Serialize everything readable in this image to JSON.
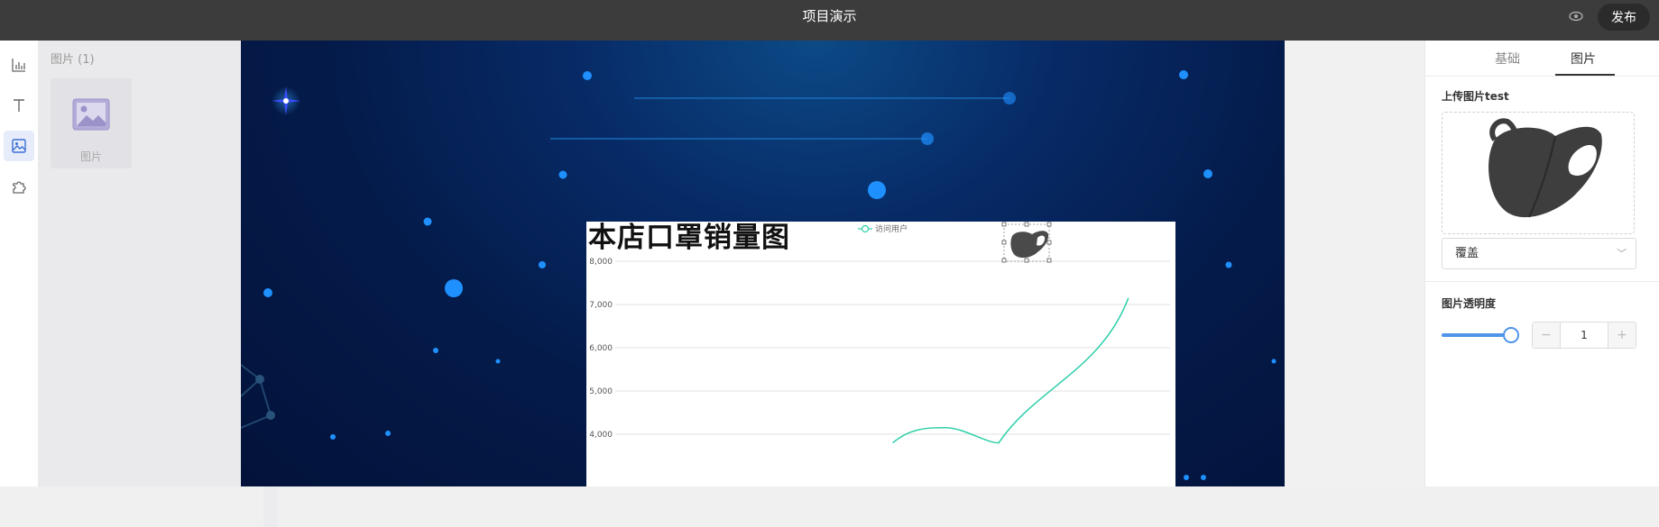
{
  "app": {
    "title": "项目演示",
    "publish_label": "发布"
  },
  "icons": {
    "preview": "eye-icon",
    "rail": [
      "chart-icon",
      "text-icon",
      "image-icon",
      "puzzle-icon"
    ]
  },
  "library": {
    "header": "图片 (1)",
    "items": [
      {
        "label": "图片",
        "icon": "image-placeholder-icon"
      }
    ]
  },
  "canvas": {
    "chart": {
      "title_text": "本店口罩销量图",
      "legend_label": "访问用户",
      "accent_color": "#2ecfa9"
    }
  },
  "chart_data": {
    "type": "line",
    "title": "本店口罩销量图",
    "series": [
      {
        "name": "访问用户",
        "color": "#2ecfa9"
      }
    ],
    "yticks": [
      "8,000",
      "7,000",
      "6,000",
      "5,000",
      "4,000"
    ],
    "ylim": [
      4000,
      8000
    ],
    "grid": true,
    "legend_position": "top-center",
    "curve_points": [
      {
        "x": 0.52,
        "y": 3800
      },
      {
        "x": 0.61,
        "y": 4150
      },
      {
        "x": 0.7,
        "y": 3800
      },
      {
        "x": 0.92,
        "y": 7150
      }
    ]
  },
  "properties": {
    "tabs": [
      {
        "label": "基础",
        "active": false
      },
      {
        "label": "图片",
        "active": true
      }
    ],
    "upload_label": "上传图片test",
    "fit_mode": "覆盖",
    "opacity_label": "图片透明度",
    "opacity_value": "1",
    "opacity_fraction": 1
  },
  "colors": {
    "topbar": "#3c3c3c",
    "accent_blue": "#4e94ea",
    "canvas_bg": "#041b4a"
  }
}
